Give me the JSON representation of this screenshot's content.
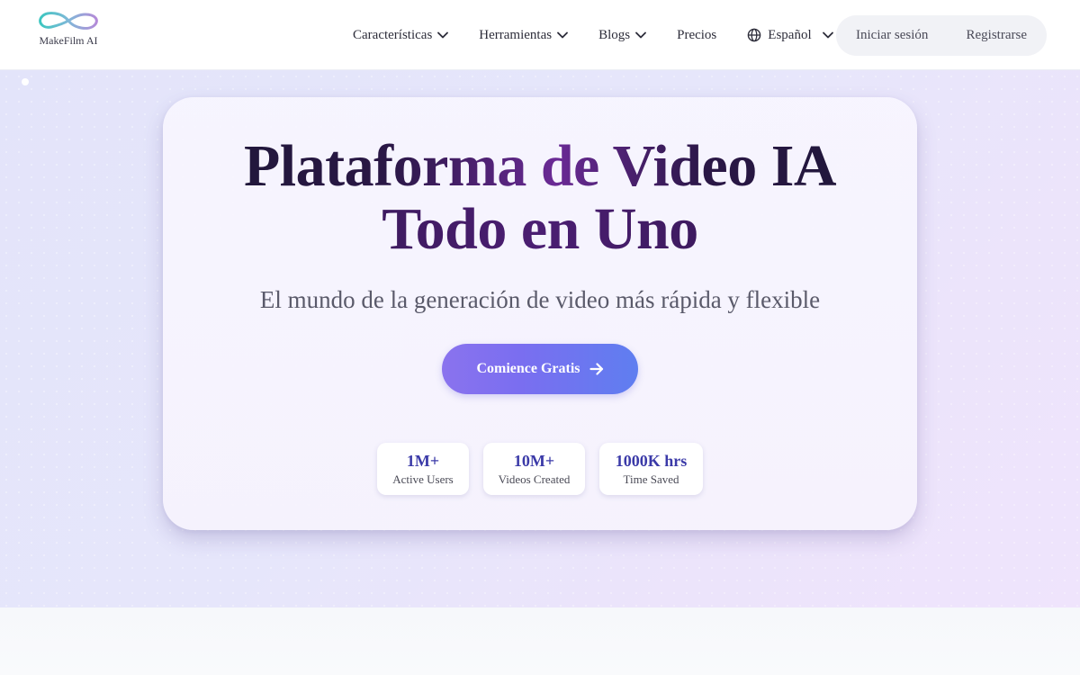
{
  "header": {
    "logo_text": "MakeFilm AI",
    "nav": [
      {
        "label": "Características",
        "has_dropdown": true
      },
      {
        "label": "Herramientas",
        "has_dropdown": true
      },
      {
        "label": "Blogs",
        "has_dropdown": true
      },
      {
        "label": "Precios",
        "has_dropdown": false
      }
    ],
    "language": {
      "label": "Español",
      "icon": "globe-icon"
    },
    "login_label": "Iniciar sesión",
    "register_label": "Registrarse"
  },
  "hero": {
    "title_line1": "Plataforma de Video IA",
    "title_line2": "Todo en Uno",
    "subtitle": "El mundo de la generación de video más rápida y flexible",
    "cta_label": "Comience Gratis",
    "cta_icon": "arrow-right-icon",
    "stats": [
      {
        "value": "1M+",
        "label": "Active Users"
      },
      {
        "value": "10M+",
        "label": "Videos Created"
      },
      {
        "value": "1000K hrs",
        "label": "Time Saved"
      }
    ]
  },
  "colors": {
    "accent_start": "#8a73ee",
    "accent_end": "#5f7ef0",
    "stat_value": "#3b3aa8",
    "hero_bg": "#e5e5fa"
  }
}
